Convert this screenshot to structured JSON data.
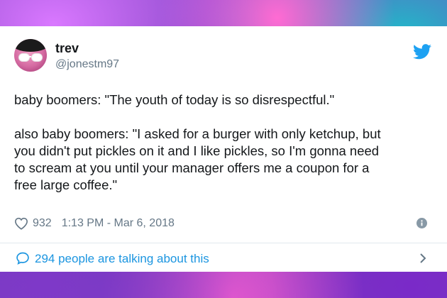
{
  "tweet": {
    "display_name": "trev",
    "handle": "@jonestm97",
    "text_lines": [
      "baby boomers: \"The youth of today is so disrespectful.\"",
      "",
      "also baby boomers: \"I asked for a burger with only ketchup, but",
      "you didn't put pickles on it and I like pickles, so I'm gonna need",
      "to scream at you until your manager offers me a coupon for a",
      "free large coffee.\""
    ],
    "likes": "932",
    "timestamp": "1:13 PM - Mar 6, 2018",
    "talking_text": "294 people are talking about this"
  },
  "icons": {
    "brand": "twitter-bird-icon",
    "like": "heart-icon",
    "info": "info-icon",
    "comment": "comment-bubble-icon",
    "next": "chevron-right-icon"
  },
  "colors": {
    "twitter_blue": "#1da1f2",
    "link_blue": "#1b95e0",
    "text_dark": "#14171a",
    "text_gray": "#657786",
    "divider": "#e1e8ed"
  }
}
